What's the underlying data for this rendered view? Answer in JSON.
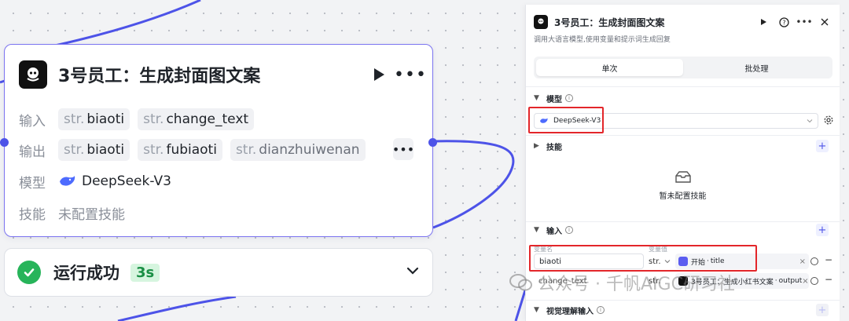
{
  "node": {
    "title": "3号员工：生成封面图文案",
    "rows": {
      "input": {
        "label": "输入",
        "tags": [
          {
            "prefix": "str.",
            "name": "biaoti"
          },
          {
            "prefix": "str.",
            "name": "change_text"
          }
        ]
      },
      "output": {
        "label": "输出",
        "tags": [
          {
            "prefix": "str.",
            "name": "biaoti"
          },
          {
            "prefix": "str.",
            "name": "fubiaoti"
          },
          {
            "prefix": "str.",
            "name": "dianzhuiwenan"
          }
        ]
      },
      "model": {
        "label": "模型",
        "value": "DeepSeek-V3"
      },
      "skill": {
        "label": "技能",
        "value": "未配置技能"
      }
    }
  },
  "status": {
    "text": "运行成功",
    "badge": "3s",
    "success_color": "#27b45a"
  },
  "panel": {
    "title": "3号员工：生成封面图文案",
    "description": "调用大语言模型,使用变量和提示词生成回复",
    "tabs": [
      {
        "label": "单次",
        "active": true
      },
      {
        "label": "批处理",
        "active": false
      }
    ],
    "model_section": {
      "title": "模型",
      "selected": "DeepSeek-V3"
    },
    "skill_section": {
      "title": "技能",
      "empty_text": "暂未配置技能"
    },
    "input_section": {
      "title": "输入",
      "col_name": "变量名",
      "col_value": "变量值",
      "rows": [
        {
          "name": "biaoti",
          "type": "str.",
          "source_node": "开始",
          "source_var": "title"
        },
        {
          "name": "change_text",
          "type": "str.",
          "source_node": "3号员工：生成小红书文案",
          "source_var": "output"
        }
      ]
    },
    "vision_section": {
      "title": "视觉理解输入"
    }
  },
  "watermark": {
    "text": "公众号 · 千帆AIGC研习社"
  },
  "colors": {
    "accent": "#4d53e8",
    "node_border": "#7b73f0",
    "highlight": "#e3262a"
  }
}
